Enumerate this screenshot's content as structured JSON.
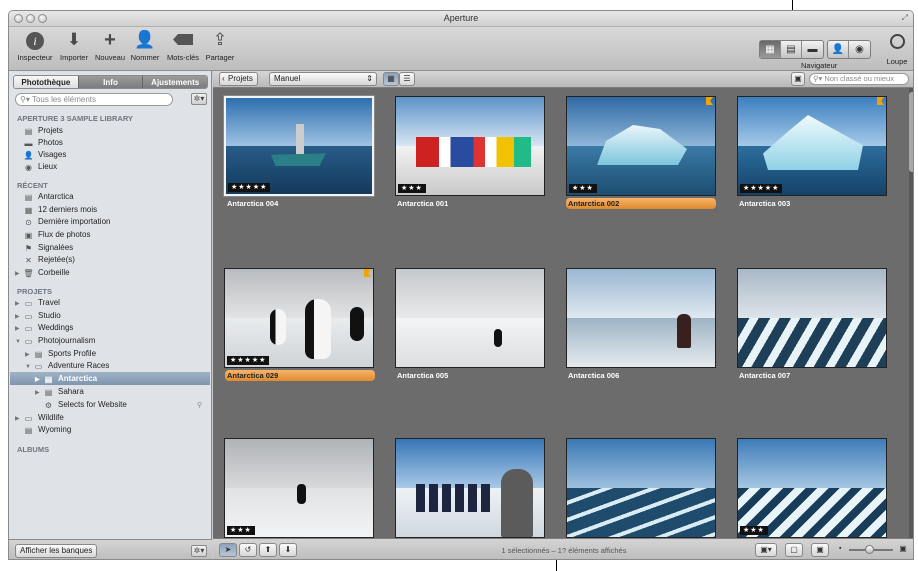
{
  "window": {
    "title": "Aperture"
  },
  "toolbar": {
    "buttons": [
      "Inspecteur",
      "Importer",
      "Nouveau",
      "Nommer",
      "Mots-clés",
      "Partager"
    ],
    "navigator_label": "Navigateur",
    "loupe_label": "Loupe"
  },
  "sidebar": {
    "tabs": [
      "Photothèque",
      "Info",
      "Ajustements"
    ],
    "search_placeholder": "Tous les éléments",
    "library_header": "APERTURE 3 SAMPLE LIBRARY",
    "library_items": [
      "Projets",
      "Photos",
      "Visages",
      "Lieux"
    ],
    "recent_header": "RÉCENT",
    "recent_items": [
      "Antarctica",
      "12 derniers mois",
      "Dernière importation",
      "Flux de photos",
      "Signalées",
      "Rejetée(s)",
      "Corbeille"
    ],
    "projects_header": "PROJETS",
    "projects": [
      "Travel",
      "Studio",
      "Weddings",
      "Photojournalism",
      "Sports Profile",
      "Adventure Races",
      "Antarctica",
      "Sahara",
      "Selects for Website",
      "Wildlife",
      "Wyoming"
    ],
    "albums_header": "ALBUMS",
    "show_vaults_label": "Afficher les banques"
  },
  "browser": {
    "projects_button": "Projets",
    "sort_value": "Manuel",
    "filter_placeholder": "Non classé ou mieux",
    "status": "1 sélectionnés – 1? éléments affichés",
    "photos": [
      {
        "name": "Antarctica 004",
        "stars": "★★★★★"
      },
      {
        "name": "Antarctica 001",
        "stars": "★★★"
      },
      {
        "name": "Antarctica 002",
        "stars": "★★★"
      },
      {
        "name": "Antarctica 003",
        "stars": "★★★★★"
      },
      {
        "name": "Antarctica 029",
        "stars": "★★★★★"
      },
      {
        "name": "Antarctica 005",
        "stars": ""
      },
      {
        "name": "Antarctica 006",
        "stars": ""
      },
      {
        "name": "Antarctica 007",
        "stars": ""
      },
      {
        "name": "",
        "stars": "★★★"
      },
      {
        "name": "",
        "stars": ""
      },
      {
        "name": "",
        "stars": ""
      },
      {
        "name": "",
        "stars": "★★★"
      }
    ]
  }
}
